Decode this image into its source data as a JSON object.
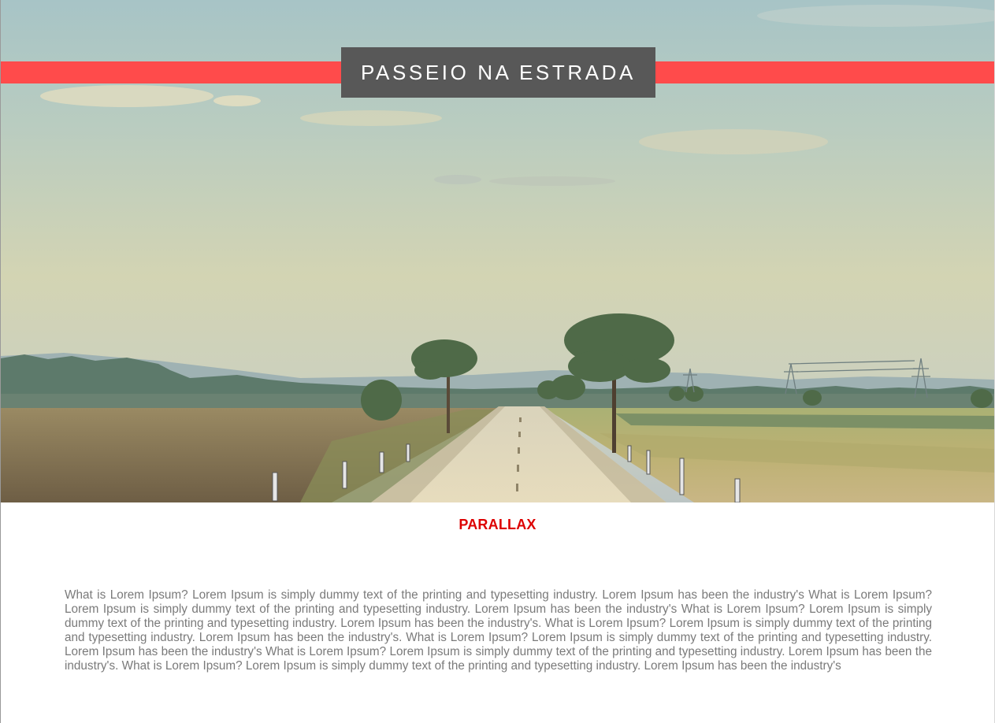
{
  "hero": {
    "title": "PASSEIO NA ESTRADA",
    "image_icon": "landscape-road-photo",
    "colors": {
      "stripe": "#ff4b4b",
      "title_box": "#585858"
    }
  },
  "section": {
    "heading": "PARALLAX",
    "heading_color": "#dd0000",
    "paragraph": "What is Lorem Ipsum? Lorem Ipsum is simply dummy text of the printing and typesetting industry. Lorem Ipsum has been the industry's What is Lorem Ipsum? Lorem Ipsum is simply dummy text of the printing and typesetting industry. Lorem Ipsum has been the industry's What is Lorem Ipsum? Lorem Ipsum is simply dummy text of the printing and typesetting industry. Lorem Ipsum has been the industry's. What is Lorem Ipsum? Lorem Ipsum is simply dummy text of the printing and typesetting industry. Lorem Ipsum has been the industry's. What is Lorem Ipsum? Lorem Ipsum is simply dummy text of the printing and typesetting industry. Lorem Ipsum has been the industry's What is Lorem Ipsum? Lorem Ipsum is simply dummy text of the printing and typesetting industry. Lorem Ipsum has been the industry's. What is Lorem Ipsum? Lorem Ipsum is simply dummy text of the printing and typesetting industry. Lorem Ipsum has been the industry's"
  }
}
